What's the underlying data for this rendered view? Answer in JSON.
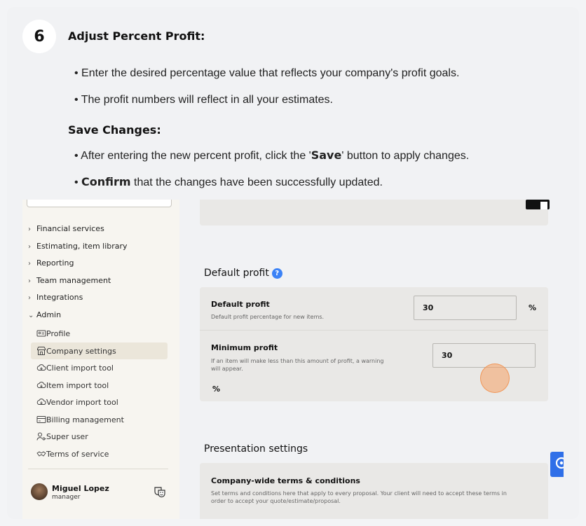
{
  "step": {
    "number": "6",
    "heading": "Adjust Percent Profit:",
    "bullets": [
      "• Enter the desired percentage value that reflects your company's profit goals.",
      "• The profit numbers will reflect in all your estimates."
    ],
    "save_heading": "Save Changes:",
    "save_bullet_prefix": "• After entering the new percent profit, click the '",
    "save_bullet_bold": "Save",
    "save_bullet_suffix": "' button to apply changes.",
    "confirm_prefix": "• ",
    "confirm_bold": "Confirm",
    "confirm_suffix": " that the changes have been successfully updated."
  },
  "sidebar": {
    "items": [
      {
        "chev": ">",
        "label": "Financial services"
      },
      {
        "chev": ">",
        "label": "Estimating, item library"
      },
      {
        "chev": ">",
        "label": "Reporting"
      },
      {
        "chev": ">",
        "label": "Team management"
      },
      {
        "chev": ">",
        "label": "Integrations"
      },
      {
        "chev": "v",
        "label": "Admin"
      }
    ],
    "admin_items": [
      {
        "label": "Profile",
        "icon": "id-card-icon"
      },
      {
        "label": "Company settings",
        "icon": "storefront-icon"
      },
      {
        "label": "Client import tool",
        "icon": "cloud-download-icon"
      },
      {
        "label": "Item import tool",
        "icon": "cloud-download-icon"
      },
      {
        "label": "Vendor import tool",
        "icon": "cloud-download-icon"
      },
      {
        "label": "Billing management",
        "icon": "credit-card-icon"
      },
      {
        "label": "Super user",
        "icon": "user-key-icon"
      },
      {
        "label": "Terms of service",
        "icon": "handshake-icon"
      }
    ],
    "user": {
      "name": "Miguel Lopez",
      "role": "manager"
    }
  },
  "settings": {
    "default_profit_section": "Default profit",
    "default_profit_title": "Default profit",
    "default_profit_desc": "Default profit percentage for new items.",
    "default_profit_value": "30",
    "minimum_profit_title": "Minimum profit",
    "minimum_profit_desc_1": "If an item will make less than this amount of profit, a warning",
    "minimum_profit_desc_2": "will appear.",
    "minimum_profit_value": "30",
    "percent_symbol": "%",
    "presentation_section": "Presentation settings",
    "terms_title": "Company-wide terms & conditions",
    "terms_desc_1": "Set terms and conditions here that apply to every proposal. Your client will need to accept these terms in",
    "terms_desc_2": "order to accept your quote/estimate/proposal."
  },
  "colors": {
    "accent_blue": "#3b82f6",
    "zoom_button": "#2f6fe8",
    "click_marker": "#f5a064"
  }
}
